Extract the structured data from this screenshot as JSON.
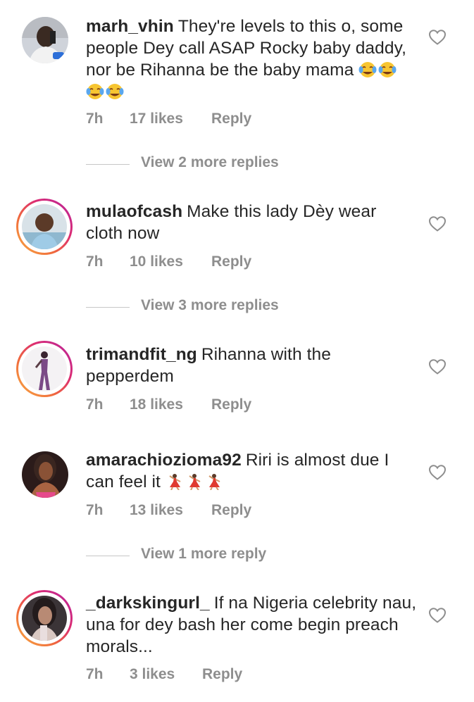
{
  "comments": [
    {
      "username": "marh_vhin",
      "text": "They're levels to this o, some people Dey call ASAP Rocky baby daddy, nor be Rihanna be the baby mama",
      "emoji": [
        "face-with-tears-of-joy",
        "face-with-tears-of-joy",
        "face-with-tears-of-joy",
        "face-with-tears-of-joy"
      ],
      "time": "7h",
      "likes": "17 likes",
      "reply": "Reply",
      "view_more": "View 2 more replies"
    },
    {
      "username": "mulaofcash",
      "text": "Make this lady Dèy wear cloth now",
      "time": "7h",
      "likes": "10 likes",
      "reply": "Reply",
      "view_more": "View 3 more replies"
    },
    {
      "username": "trimandfit_ng",
      "text": "Rihanna with the pepperdem",
      "time": "7h",
      "likes": "18 likes",
      "reply": "Reply"
    },
    {
      "username": "amarachiozioma92",
      "text": "Riri is almost due I can feel it",
      "emoji": [
        "woman-dancing",
        "woman-dancing",
        "woman-dancing"
      ],
      "time": "7h",
      "likes": "13 likes",
      "reply": "Reply",
      "view_more": "View 1 more reply"
    },
    {
      "username": "_darkskingurl_",
      "text": "If na Nigeria celebrity nau, una for dey bash her come begin preach morals...",
      "time": "7h",
      "likes": "3 likes",
      "reply": "Reply"
    }
  ],
  "icons": {
    "like": "heart-outline-icon"
  },
  "colors": {
    "text": "#262626",
    "muted": "#8e8e8e",
    "story_ring": "#dc2b72"
  }
}
